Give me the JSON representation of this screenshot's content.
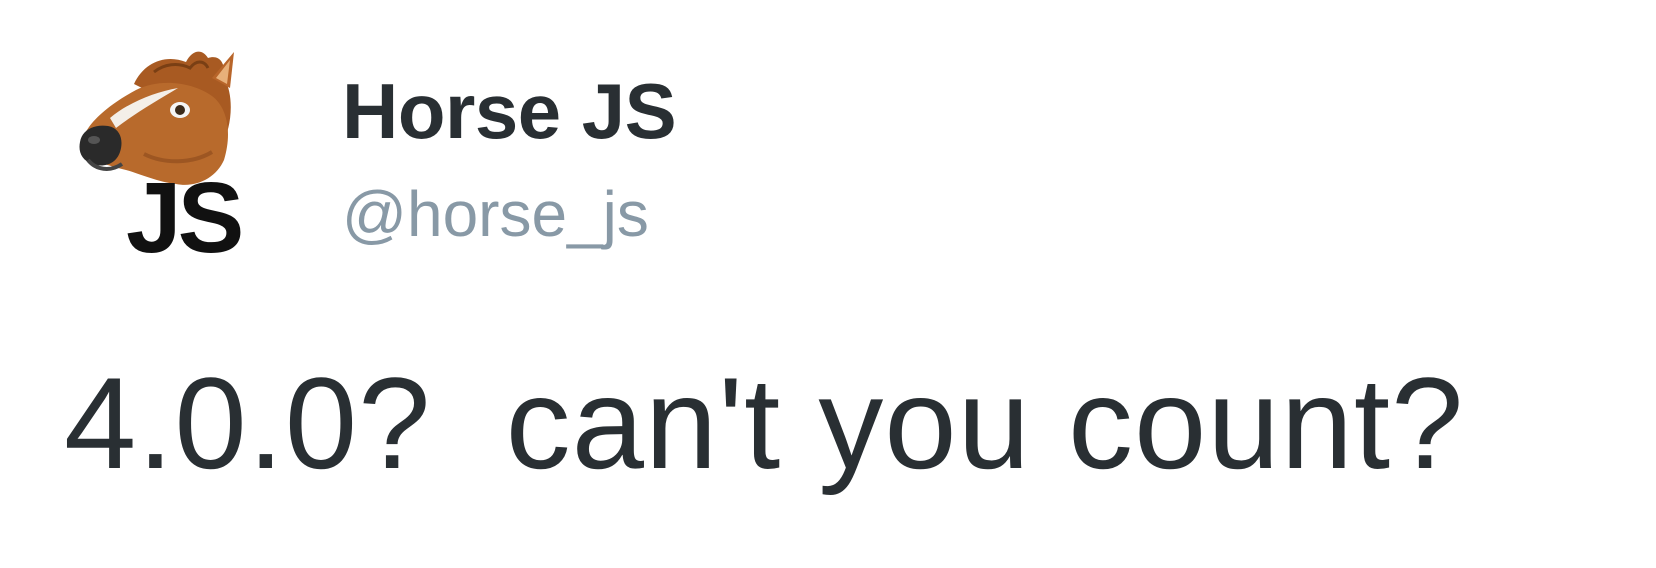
{
  "tweet": {
    "author": {
      "display_name": "Horse JS",
      "handle": "@horse_js",
      "avatar_icon": "horse-head-js-logo",
      "avatar_text": "JS"
    },
    "text": "4.0.0?  can't you count?"
  },
  "colors": {
    "name": "#292f33",
    "handle": "#8899a6",
    "text": "#292f33",
    "background": "#ffffff"
  }
}
